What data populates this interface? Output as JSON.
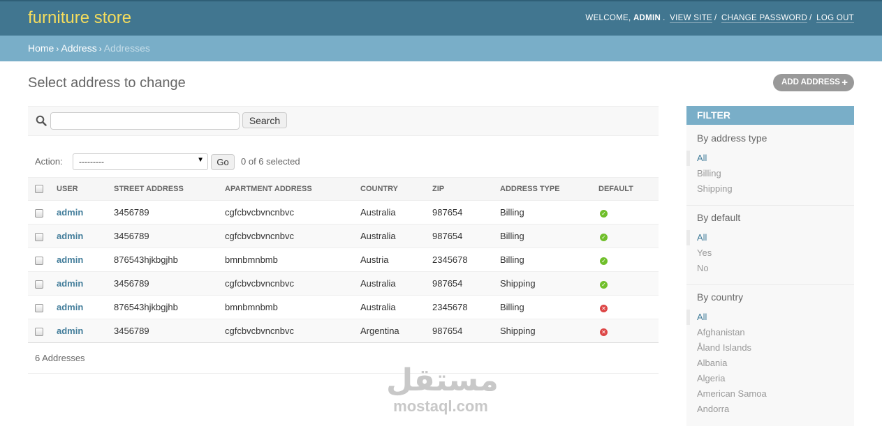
{
  "header": {
    "branding": "furniture store",
    "welcome": "Welcome,",
    "username": "admin",
    "view_site": "View site",
    "change_password": "Change password",
    "log_out": "Log out"
  },
  "breadcrumbs": {
    "home": "Home",
    "app": "Address",
    "current": "Addresses"
  },
  "page_title": "Select address to change",
  "add_button": "Add address",
  "search": {
    "value": "",
    "placeholder": "",
    "button": "Search"
  },
  "actions": {
    "label": "Action:",
    "selected": "---------",
    "go": "Go",
    "counter": "0 of 6 selected"
  },
  "table": {
    "columns": [
      "User",
      "Street address",
      "Apartment address",
      "Country",
      "Zip",
      "Address type",
      "Default"
    ],
    "rows": [
      {
        "user": "admin",
        "street": "3456789",
        "apartment": "cgfcbvcbvncnbvc",
        "country": "Australia",
        "zip": "987654",
        "type": "Billing",
        "default": true
      },
      {
        "user": "admin",
        "street": "3456789",
        "apartment": "cgfcbvcbvncnbvc",
        "country": "Australia",
        "zip": "987654",
        "type": "Billing",
        "default": true
      },
      {
        "user": "admin",
        "street": "876543hjkbgjhb",
        "apartment": "bmnbmnbmb",
        "country": "Austria",
        "zip": "2345678",
        "type": "Billing",
        "default": true
      },
      {
        "user": "admin",
        "street": "3456789",
        "apartment": "cgfcbvcbvncnbvc",
        "country": "Australia",
        "zip": "987654",
        "type": "Shipping",
        "default": true
      },
      {
        "user": "admin",
        "street": "876543hjkbgjhb",
        "apartment": "bmnbmnbmb",
        "country": "Australia",
        "zip": "2345678",
        "type": "Billing",
        "default": false
      },
      {
        "user": "admin",
        "street": "3456789",
        "apartment": "cgfcbvcbvncnbvc",
        "country": "Argentina",
        "zip": "987654",
        "type": "Shipping",
        "default": false
      }
    ]
  },
  "paginator": "6 Addresses",
  "filter": {
    "title": "Filter",
    "groups": [
      {
        "heading": "By address type",
        "options": [
          "All",
          "Billing",
          "Shipping"
        ]
      },
      {
        "heading": "By default",
        "options": [
          "All",
          "Yes",
          "No"
        ]
      },
      {
        "heading": "By country",
        "options": [
          "All",
          "Afghanistan",
          "Åland Islands",
          "Albania",
          "Algeria",
          "American Samoa",
          "Andorra"
        ]
      }
    ]
  },
  "watermark": {
    "arabic": "مستقل",
    "latin": "mostaql.com"
  },
  "colors": {
    "header": "#417690",
    "breadcrumbs": "#79aec8",
    "branding": "#f5dd5d",
    "link": "#447e9b",
    "yes": "#70bf2b",
    "no": "#dd4646"
  }
}
